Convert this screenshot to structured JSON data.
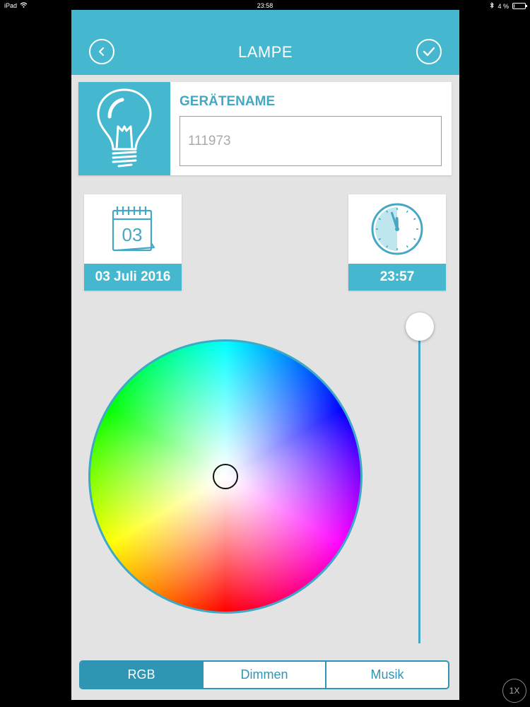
{
  "status_bar": {
    "device": "iPad",
    "time": "23:58",
    "battery": "4 %",
    "battery_level": 0.04
  },
  "header": {
    "title": "LAMPE",
    "back_icon": "chevron-left-icon",
    "confirm_icon": "check-icon"
  },
  "device": {
    "icon": "lightbulb-icon",
    "label": "GERÄTENAME",
    "name_value": "111973"
  },
  "date_tile": {
    "icon": "calendar-icon",
    "day": "03",
    "date": "03 Juli 2016"
  },
  "time_tile": {
    "icon": "clock-icon",
    "time": "23:57",
    "hour": 23,
    "minute": 57
  },
  "color_picker": {
    "selected_color": "#ffffff",
    "saturation": 0
  },
  "brightness": {
    "level": 1.0
  },
  "tabs": [
    {
      "label": "RGB",
      "active": true
    },
    {
      "label": "Dimmen",
      "active": false
    },
    {
      "label": "Musik",
      "active": false
    }
  ],
  "zoom_badge": "1X",
  "colors": {
    "accent": "#45b8d0",
    "accent_dark": "#2f95b3",
    "background": "#e3e3e3",
    "label_blue": "#45a7c4"
  }
}
